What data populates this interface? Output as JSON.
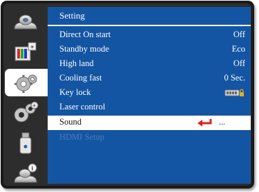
{
  "menu": {
    "title": "Setting",
    "tabs": [
      {
        "icon": "display-icon",
        "active": false
      },
      {
        "icon": "image-adjust-icon",
        "active": false
      },
      {
        "icon": "setting-gear-icon",
        "active": true
      },
      {
        "icon": "expanded-setting-icon",
        "active": false
      },
      {
        "icon": "usb-memory-icon",
        "active": false
      },
      {
        "icon": "information-icon",
        "active": false
      }
    ],
    "items": [
      {
        "label": "Direct On start",
        "value": "Off"
      },
      {
        "label": "Standby mode",
        "value": "Eco"
      },
      {
        "label": "High land",
        "value": "Off"
      },
      {
        "label": "Cooling fast",
        "value": "0 Sec."
      },
      {
        "label": "Key lock",
        "value_icon": "keylock-icon"
      },
      {
        "label": "Laser control",
        "value": ""
      },
      {
        "label": "Sound",
        "value": "...",
        "selected": true,
        "enter_icon": "enter-arrow-icon"
      },
      {
        "label": "HDMI Setup",
        "value": "",
        "disabled": true
      }
    ]
  },
  "colors": {
    "panel_blue": "#1455a3",
    "frame": "#1a1a1a",
    "enter_arrow_red": "#e0201b",
    "disabled_text": "#4f7ab5"
  }
}
